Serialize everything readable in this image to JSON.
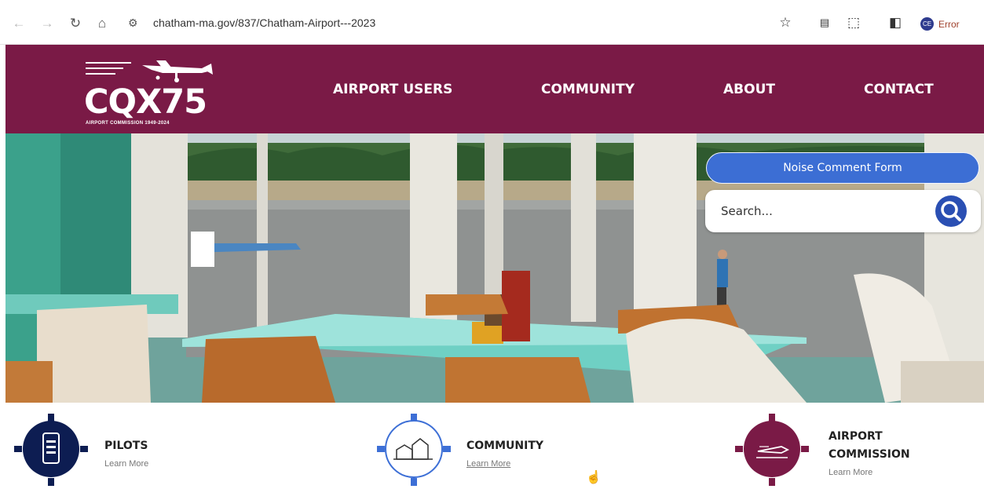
{
  "browser": {
    "url": "chatham-ma.gov/837/Chatham-Airport---2023",
    "profile_status": "Error"
  },
  "logo": {
    "name": "CQX75",
    "tagline": "AIRPORT COMMISSION 1949-2024"
  },
  "nav": {
    "items": [
      {
        "label": "AIRPORT USERS"
      },
      {
        "label": "COMMUNITY"
      },
      {
        "label": "ABOUT"
      },
      {
        "label": "CONTACT"
      }
    ]
  },
  "hero": {
    "noise_button": "Noise Comment Form",
    "search_placeholder": "Search..."
  },
  "quick_links": [
    {
      "title": "PILOTS",
      "learn": "Learn More",
      "icon": "phone-checklist-icon",
      "color": "#0d1d52"
    },
    {
      "title": "COMMUNITY",
      "learn": "Learn More",
      "icon": "buildings-icon",
      "color": "#3d6fd6"
    },
    {
      "title": "AIRPORT",
      "title2": "COMMISSION",
      "learn": "Learn More",
      "icon": "airplane-icon",
      "color": "#7a1a46"
    }
  ],
  "colors": {
    "header": "#7a1a46",
    "button": "#3c6ed4",
    "search_button": "#2a4fb3"
  }
}
